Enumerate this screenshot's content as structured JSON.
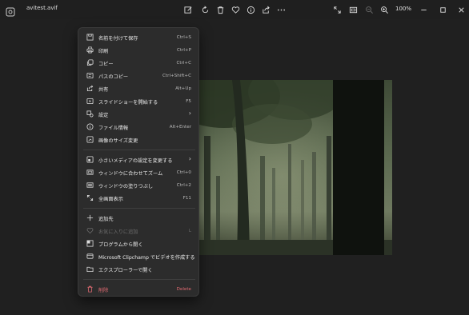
{
  "titlebar": {
    "filename": "avitest.avif",
    "zoom": "100%",
    "icons": [
      "edit-icon",
      "rotate-icon",
      "delete-icon",
      "favorite-icon",
      "info-icon",
      "share-icon",
      "more-icon",
      "fullscreen-icon",
      "fit-icon",
      "zoom-out-icon",
      "zoom-in-icon",
      "minimize-icon",
      "maximize-icon",
      "close-icon"
    ]
  },
  "menu": {
    "items": [
      {
        "label": "名前を付けて保存",
        "shortcut": "Ctrl+S",
        "icon": "save-icon"
      },
      {
        "label": "印刷",
        "shortcut": "Ctrl+P",
        "icon": "print-icon"
      },
      {
        "label": "コピー",
        "shortcut": "Ctrl+C",
        "icon": "copy-icon"
      },
      {
        "label": "パスのコピー",
        "shortcut": "Ctrl+Shift+C",
        "icon": "copy-path-icon"
      },
      {
        "label": "共有",
        "shortcut": "Alt+Up",
        "icon": "share-icon"
      },
      {
        "label": "スライドショーを開始する",
        "shortcut": "F5",
        "icon": "slideshow-icon"
      },
      {
        "label": "設定",
        "shortcut": "",
        "icon": "settings-icon",
        "submenu": true
      },
      {
        "label": "ファイル情報",
        "shortcut": "Alt+Enter",
        "icon": "info-icon"
      },
      {
        "label": "画像のサイズ変更",
        "shortcut": "",
        "icon": "resize-icon"
      },
      {
        "label": "小さいメディアの設定を変更する",
        "shortcut": "",
        "icon": "small-media-icon",
        "submenu": true
      },
      {
        "label": "ウィンドウに合わせてズーム",
        "shortcut": "Ctrl+0",
        "icon": "zoom-fit-icon"
      },
      {
        "label": "ウィンドウの塗りつぶし",
        "shortcut": "Ctrl+2",
        "icon": "fill-window-icon"
      },
      {
        "label": "全画面表示",
        "shortcut": "F11",
        "icon": "fullscreen-icon"
      },
      {
        "label": "追加先",
        "shortcut": "",
        "icon": "add-icon"
      },
      {
        "label": "お気に入りに追加",
        "shortcut": "L",
        "icon": "favorite-icon",
        "disabled": true
      },
      {
        "label": "プログラムから開く",
        "shortcut": "",
        "icon": "open-with-icon"
      },
      {
        "label": "Microsoft Clipchamp でビデオを作成する",
        "shortcut": "",
        "icon": "clipchamp-icon"
      },
      {
        "label": "エクスプローラーで開く",
        "shortcut": "",
        "icon": "folder-icon"
      },
      {
        "label": "削除",
        "shortcut": "Delete",
        "icon": "delete-icon",
        "danger": true
      }
    ],
    "submenu_arrow": "›"
  },
  "colors": {
    "background": "#202020",
    "menu_bg": "#2c2c2c",
    "danger": "#e06a72",
    "disabled": "#6c6c6c"
  }
}
